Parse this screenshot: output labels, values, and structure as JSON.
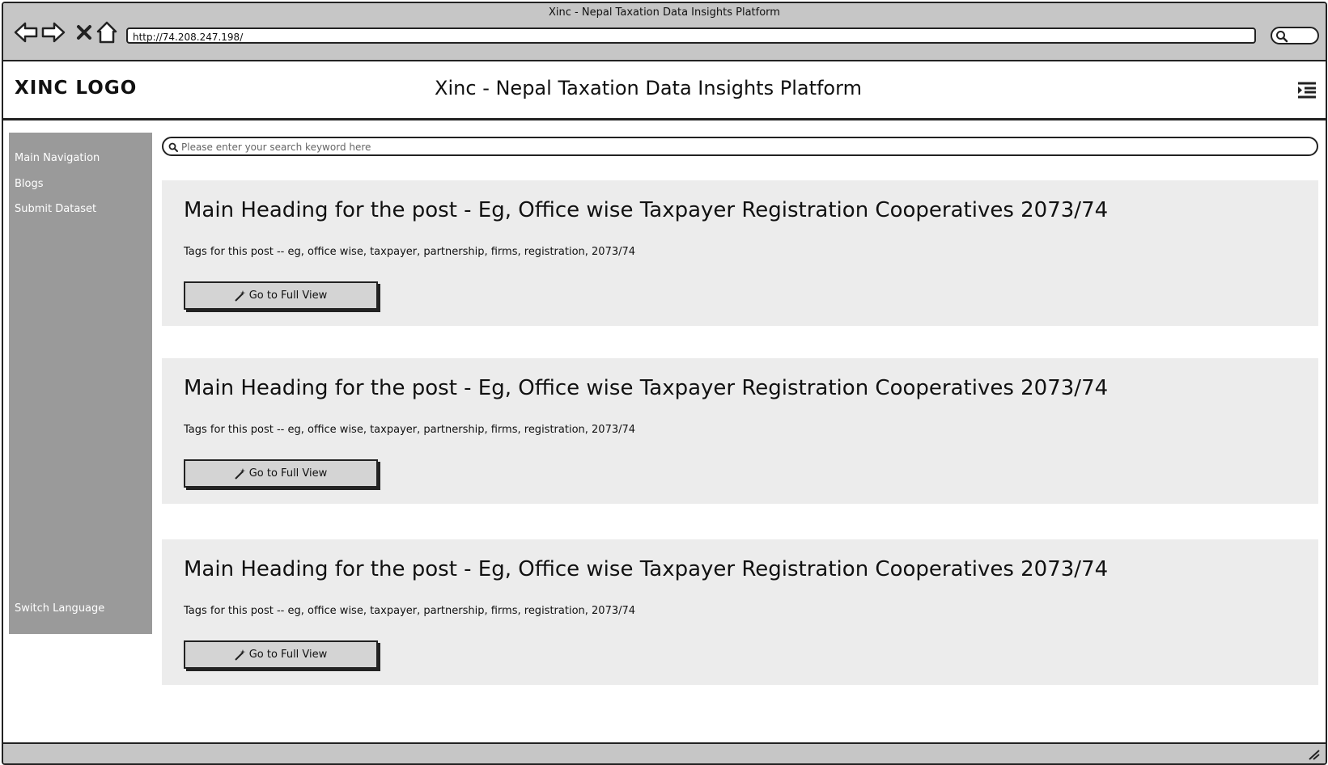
{
  "browser": {
    "window_title": "Xinc - Nepal Taxation Data Insights Platform",
    "url": "http://74.208.247.198/",
    "nav_icons": [
      "back-icon",
      "forward-icon",
      "close-icon",
      "home-icon"
    ],
    "search_icon": "search-icon"
  },
  "header": {
    "logo": "XINC LOGO",
    "title": "Xinc - Nepal Taxation Data Insights Platform",
    "menu_icon": "menu-icon"
  },
  "sidebar": {
    "items": [
      {
        "label": "Main Navigation"
      },
      {
        "label": "Blogs"
      },
      {
        "label": "Submit Dataset"
      }
    ],
    "footer_label": "Switch Language"
  },
  "search": {
    "placeholder": "Please enter your search keyword here",
    "value": ""
  },
  "posts": [
    {
      "title": "Main Heading for the post - Eg, Office wise Taxpayer Registration Cooperatives 2073/74",
      "tags": "Tags for this post -- eg, office wise, taxpayer, partnership, firms, registration, 2073/74",
      "button_label": "Go to Full View"
    },
    {
      "title": "Main Heading for the post - Eg, Office wise Taxpayer Registration Cooperatives 2073/74",
      "tags": "Tags for this post -- eg, office wise, taxpayer, partnership, firms, registration, 2073/74",
      "button_label": "Go to Full View"
    },
    {
      "title": "Main Heading for the post - Eg, Office wise Taxpayer Registration Cooperatives 2073/74",
      "tags": "Tags for this post -- eg, office wise, taxpayer, partnership, firms, registration, 2073/74",
      "button_label": "Go to Full View"
    }
  ],
  "colors": {
    "chrome": "#c6c6c6",
    "sidebar": "#9a9a9a",
    "card": "#ececec",
    "button": "#d4d4d4",
    "border": "#222222"
  }
}
